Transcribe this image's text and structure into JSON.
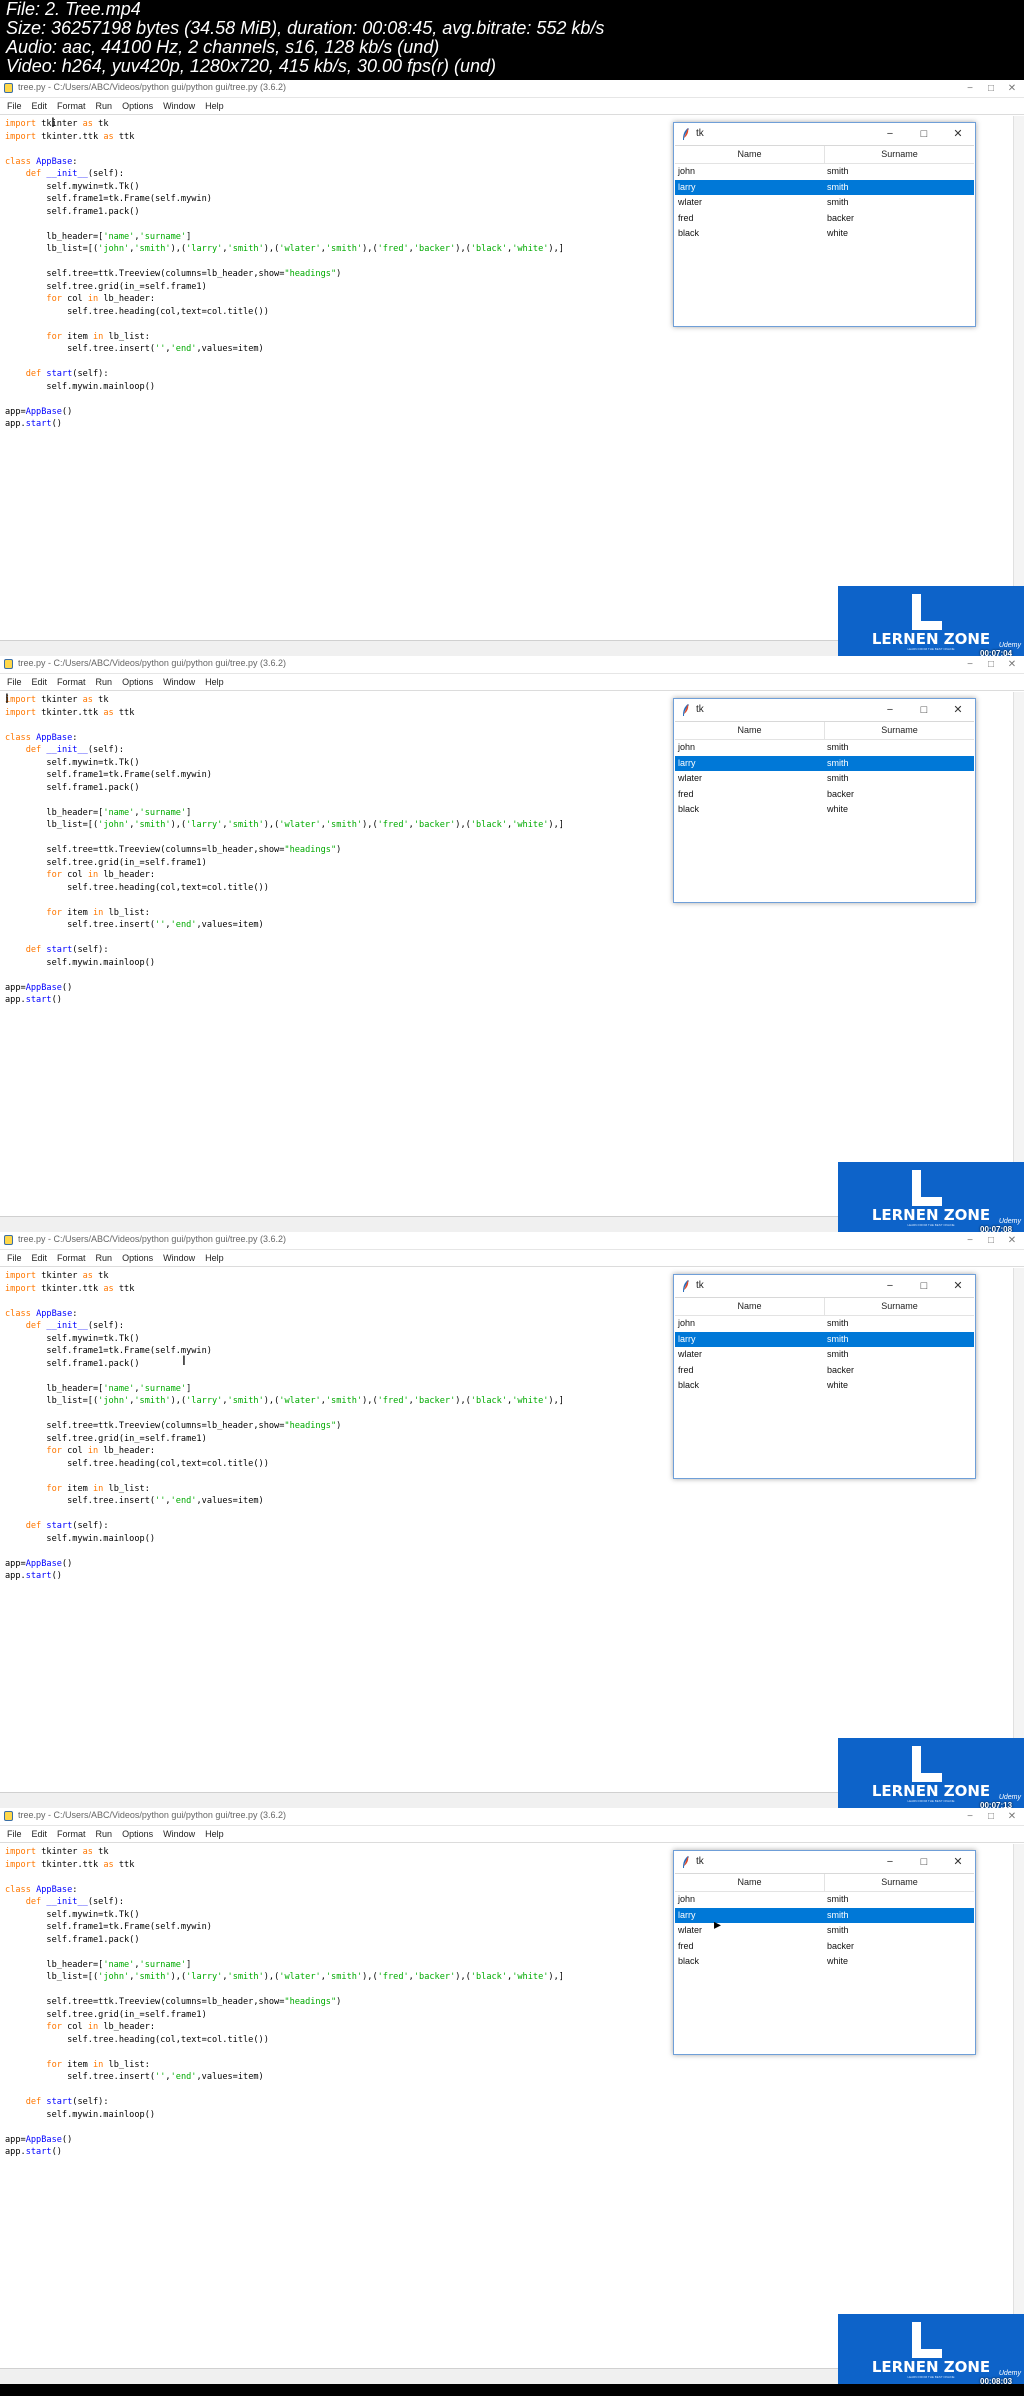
{
  "file_info": {
    "file": "File: 2. Tree.mp4",
    "size": "Size: 36257198 bytes (34.58 MiB), duration: 00:08:45, avg.bitrate: 552 kb/s",
    "audio": "Audio: aac, 44100 Hz, 2 channels, s16, 128 kb/s (und)",
    "video": "Video: h264, yuv420p, 1280x720, 415 kb/s, 30.00 fps(r) (und)"
  },
  "idle_window": {
    "title": "tree.py - C:/Users/ABC/Videos/python gui/python gui/tree.py (3.6.2)",
    "controls": [
      "−",
      "□",
      "✕"
    ],
    "menu": [
      "File",
      "Edit",
      "Format",
      "Run",
      "Options",
      "Window",
      "Help"
    ]
  },
  "code_lines": [
    "import tkinter as tk",
    "import tkinter.ttk as ttk",
    "",
    "class AppBase:",
    "    def __init__(self):",
    "        self.mywin=tk.Tk()",
    "        self.frame1=tk.Frame(self.mywin)",
    "        self.frame1.pack()",
    "",
    "        lb_header=['name','surname']",
    "        lb_list=[('john','smith'),('larry','smith'),('wlater','smith'),('fred','backer'),('black','white'),]",
    "",
    "        self.tree=ttk.Treeview(columns=lb_header,show=\"headings\")",
    "        self.tree.grid(in_=self.frame1)",
    "        for col in lb_header:",
    "            self.tree.heading(col,text=col.title())",
    "",
    "        for item in lb_list:",
    "            self.tree.insert('','end',values=item)",
    "",
    "    def start(self):",
    "        self.mywin.mainloop()",
    "",
    "app=AppBase()",
    "app.start()"
  ],
  "tk_window": {
    "title": "tk",
    "controls": [
      "−",
      "□",
      "✕"
    ],
    "columns": [
      "Name",
      "Surname"
    ],
    "rows": [
      [
        "john",
        "smith"
      ],
      [
        "larry",
        "smith"
      ],
      [
        "wlater",
        "smith"
      ],
      [
        "fred",
        "backer"
      ],
      [
        "black",
        "white"
      ]
    ]
  },
  "logo": {
    "text": "LERNEN ZONE",
    "tagline": "LEARN FROM THE BEST ONLINE",
    "platform": "Udemy"
  },
  "frames": [
    {
      "timestamp": "00:07:04",
      "selected_row": 1
    },
    {
      "timestamp": "00:07:08",
      "selected_row": 1
    },
    {
      "timestamp": "00:07:13",
      "selected_row": 1
    },
    {
      "timestamp": "00:08:03",
      "selected_row": 1
    }
  ],
  "colors": {
    "selection": "#0078d7",
    "keyword": "#ff7700",
    "classname": "#0000ff",
    "string": "#00aa00",
    "logo_bg": "#0d63c9"
  }
}
